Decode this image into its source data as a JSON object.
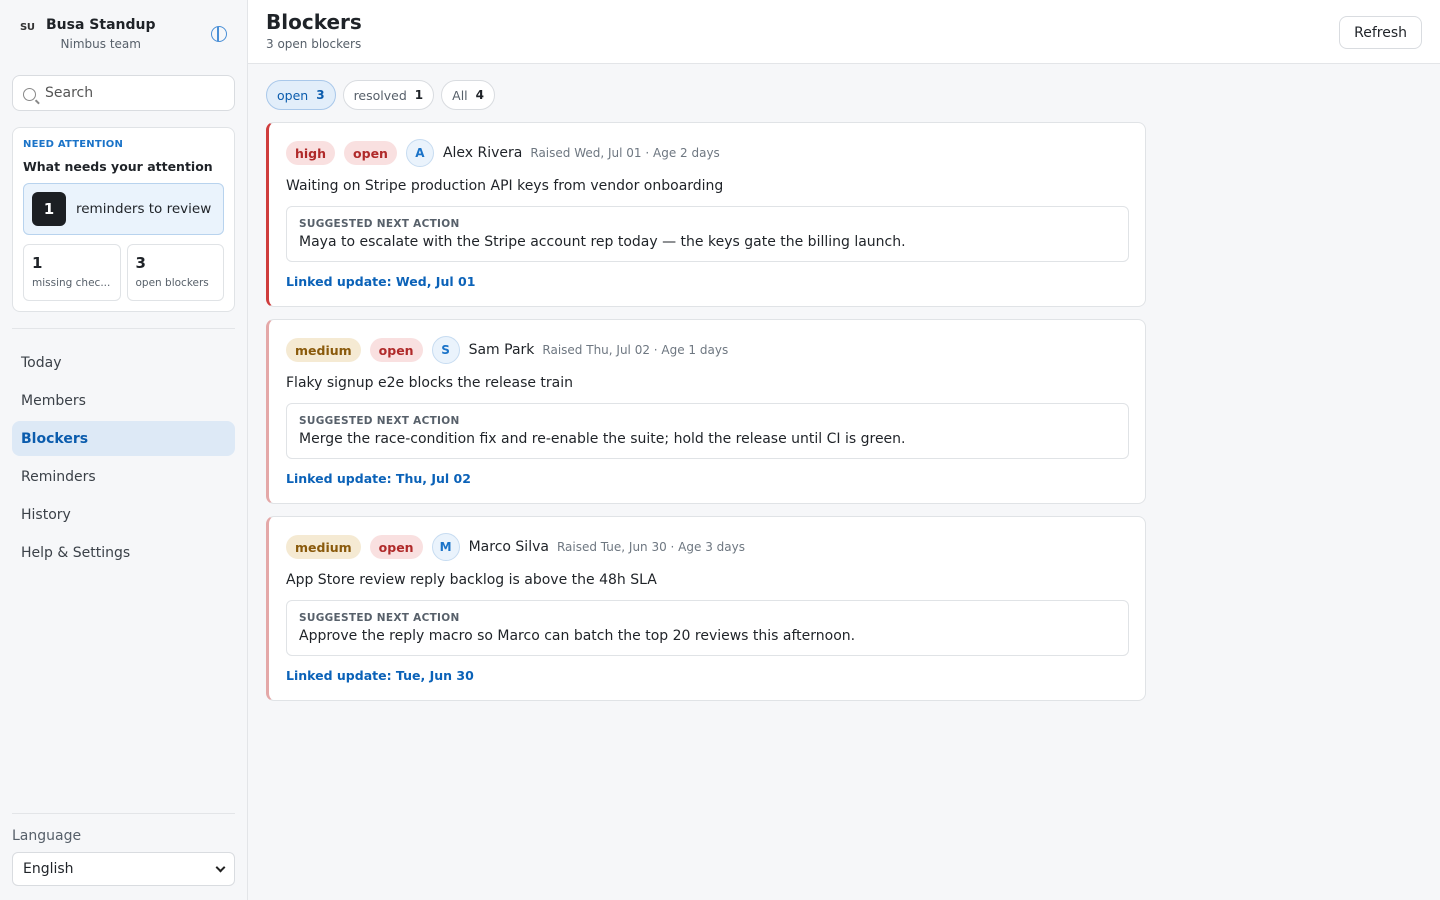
{
  "sidebar": {
    "logo": "SU",
    "app_name": "Busa Standup",
    "team_name": "Nimbus team",
    "toggle_icon": "panel-toggle-icon",
    "search": {
      "placeholder": "Search",
      "value": ""
    },
    "attention": {
      "kicker": "NEED ATTENTION",
      "title": "What needs your attention",
      "reminders_count": "1",
      "reminders_label": "reminders to review",
      "stats": [
        {
          "value": "1",
          "label": "missing chec..."
        },
        {
          "value": "3",
          "label": "open blockers"
        }
      ]
    },
    "nav": [
      {
        "label": "Today",
        "active": false
      },
      {
        "label": "Members",
        "active": false
      },
      {
        "label": "Blockers",
        "active": true
      },
      {
        "label": "Reminders",
        "active": false
      },
      {
        "label": "History",
        "active": false
      },
      {
        "label": "Help & Settings",
        "active": false
      }
    ],
    "language": {
      "label": "Language",
      "selected": "English"
    }
  },
  "header": {
    "title": "Blockers",
    "subtitle": "3 open blockers",
    "refresh_label": "Refresh"
  },
  "filters": [
    {
      "label": "open",
      "count": "3",
      "active": true
    },
    {
      "label": "resolved",
      "count": "1",
      "active": false
    },
    {
      "label": "All",
      "count": "4",
      "active": false
    }
  ],
  "blockers": [
    {
      "severity": "high",
      "status": "open",
      "initial": "A",
      "person": "Alex Rivera",
      "meta": "Raised Wed, Jul 01 · Age 2 days",
      "title": "Waiting on Stripe production API keys from vendor onboarding",
      "action_kicker": "SUGGESTED NEXT ACTION",
      "action": "Maya to escalate with the Stripe account rep today — the keys gate the billing launch.",
      "linked": "Linked update: Wed, Jul 01"
    },
    {
      "severity": "medium",
      "status": "open",
      "initial": "S",
      "person": "Sam Park",
      "meta": "Raised Thu, Jul 02 · Age 1 days",
      "title": "Flaky signup e2e blocks the release train",
      "action_kicker": "SUGGESTED NEXT ACTION",
      "action": "Merge the race-condition fix and re-enable the suite; hold the release until CI is green.",
      "linked": "Linked update: Thu, Jul 02"
    },
    {
      "severity": "medium",
      "status": "open",
      "initial": "M",
      "person": "Marco Silva",
      "meta": "Raised Tue, Jun 30 · Age 3 days",
      "title": "App Store review reply backlog is above the 48h SLA",
      "action_kicker": "SUGGESTED NEXT ACTION",
      "action": "Approve the reply macro so Marco can batch the top 20 reviews this afternoon.",
      "linked": "Linked update: Tue, Jun 30"
    }
  ],
  "colors": {
    "accent": "#1a73c8",
    "high": "#cf3d3d",
    "medium_border": "#e4a8a8",
    "nav_active_bg": "#dde9f6"
  }
}
